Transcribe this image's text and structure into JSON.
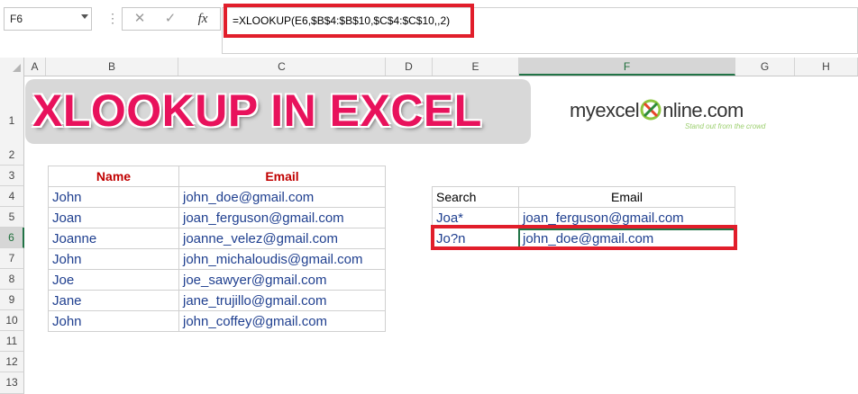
{
  "namebox": {
    "value": "F6"
  },
  "formula_bar": {
    "cancel_icon": "✕",
    "enter_icon": "✓",
    "fx_label": "fx",
    "formula": "=XLOOKUP(E6,$B$4:$B$10,$C$4:$C$10,,2)"
  },
  "columns": [
    "A",
    "B",
    "C",
    "D",
    "E",
    "F",
    "G",
    "H"
  ],
  "selected_column": "F",
  "rows": [
    "1",
    "2",
    "3",
    "4",
    "5",
    "6",
    "7",
    "8",
    "9",
    "10",
    "11",
    "12",
    "13"
  ],
  "selected_row": "6",
  "banner": {
    "title": "XLOOKUP IN EXCEL"
  },
  "logo": {
    "part1": "myexcel",
    "part2": "nline.com",
    "tagline": "Stand out from the crowd"
  },
  "main_table": {
    "headers": [
      "Name",
      "Email"
    ],
    "rows": [
      [
        "John",
        "john_doe@gmail.com"
      ],
      [
        "Joan",
        "joan_ferguson@gmail.com"
      ],
      [
        "Joanne",
        "joanne_velez@gmail.com"
      ],
      [
        "John",
        "john_michaloudis@gmail.com"
      ],
      [
        "Joe",
        "joe_sawyer@gmail.com"
      ],
      [
        "Jane",
        "jane_trujillo@gmail.com"
      ],
      [
        "John",
        "john_coffey@gmail.com"
      ]
    ]
  },
  "search_table": {
    "headers": [
      "Search",
      "Email"
    ],
    "rows": [
      [
        "Joa*",
        "joan_ferguson@gmail.com"
      ],
      [
        "Jo?n",
        "john_doe@gmail.com"
      ]
    ]
  },
  "colors": {
    "highlight": "#e11e2b",
    "excel_green": "#217346",
    "banner_text": "#e8125c",
    "header_text": "#c00000"
  }
}
